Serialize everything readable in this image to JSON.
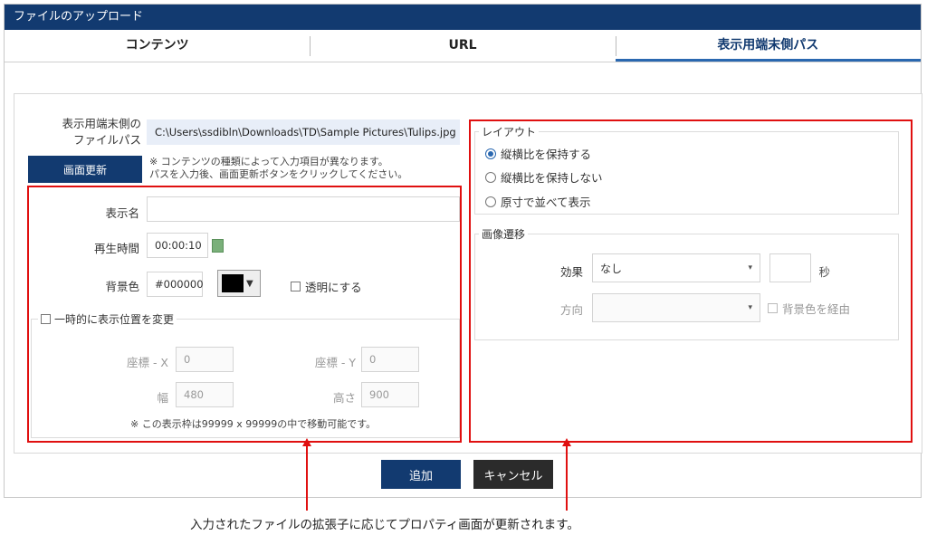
{
  "dialog": {
    "title": "ファイルのアップロード"
  },
  "tabs": [
    {
      "label": "コンテンツ"
    },
    {
      "label": "URL"
    },
    {
      "label": "表示用端末側パス"
    }
  ],
  "path_section": {
    "label_line1": "表示用端末側の",
    "label_line2": "ファイルパス",
    "value": "C:\\Users\\ssdibln\\Downloads\\TD\\Sample Pictures\\Tulips.jpg",
    "refresh_button": "画面更新",
    "note_line1": "※ コンテンツの種類によって入力項目が異なります。",
    "note_line2": "パスを入力後、画面更新ボタンをクリックしてください。"
  },
  "properties": {
    "display_name_label": "表示名",
    "display_name_value": "",
    "playtime_label": "再生時間",
    "playtime_value": "00:00:10",
    "bgcolor_label": "背景色",
    "bgcolor_value": "#000000",
    "transparent_label": "透明にする",
    "temp_position_label": "一時的に表示位置を変更",
    "x_label": "座標 - X",
    "x_value": "0",
    "y_label": "座標 - Y",
    "y_value": "0",
    "width_label": "幅",
    "width_value": "480",
    "height_label": "高さ",
    "height_value": "900",
    "range_note": "※ この表示枠は99999 x 99999の中で移動可能です。"
  },
  "layout_section": {
    "legend": "レイアウト",
    "options": [
      {
        "label": "縦横比を保持する",
        "selected": true
      },
      {
        "label": "縦横比を保持しない",
        "selected": false
      },
      {
        "label": "原寸で並べて表示",
        "selected": false
      }
    ]
  },
  "transition_section": {
    "legend": "画像遷移",
    "effect_label": "効果",
    "effect_value": "なし",
    "seconds_value": "",
    "seconds_unit": "秒",
    "direction_label": "方向",
    "direction_value": "",
    "via_bg_label": "背景色を経由"
  },
  "footer": {
    "add_button": "追加",
    "cancel_button": "キャンセル"
  },
  "annotation": {
    "caption": "入力されたファイルの拡張子に応じてプロパティ画面が更新されます。"
  },
  "colors": {
    "header": "#123a70",
    "accent": "#2a68b0",
    "highlight": "#e01010",
    "cancel": "#2b2b2b"
  }
}
